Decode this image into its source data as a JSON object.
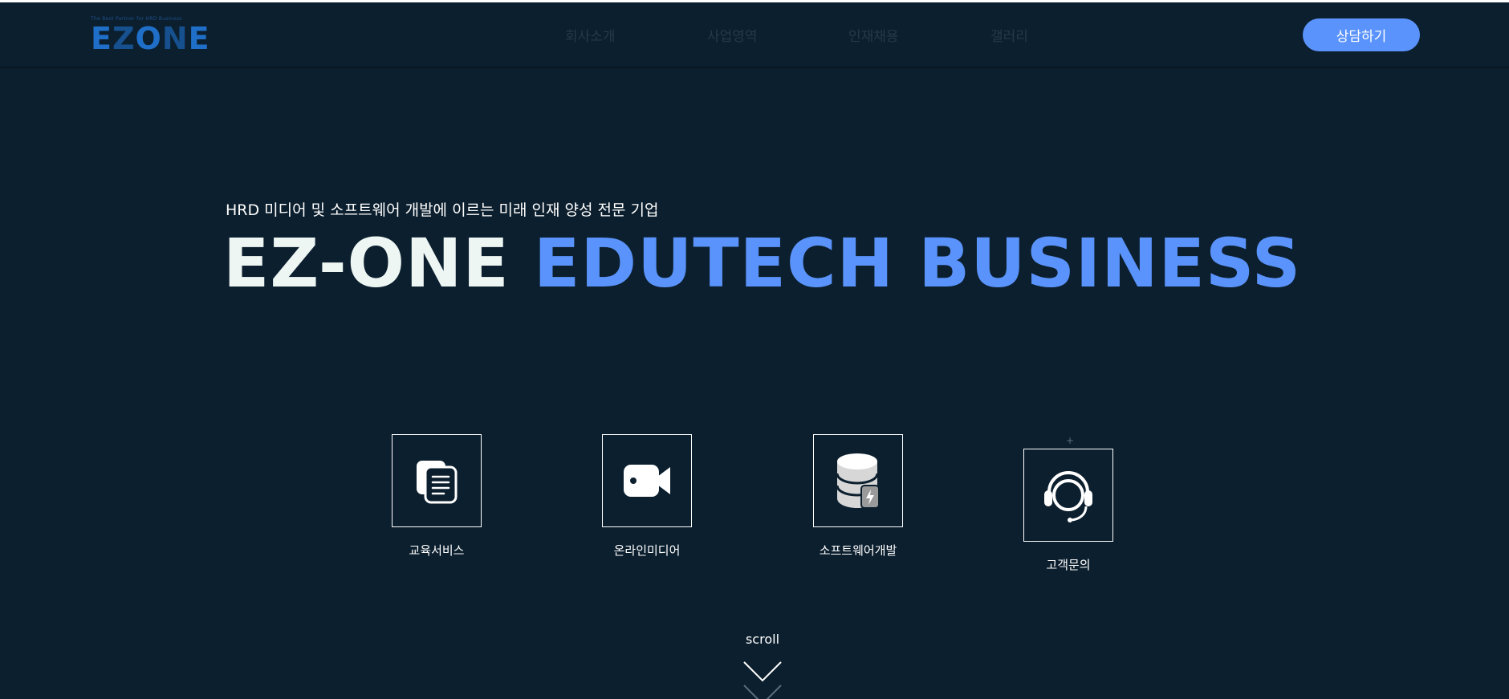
{
  "header": {
    "logo": {
      "tagline": "The Best Partner for HRD Business",
      "word": "EZONE"
    },
    "nav": [
      "회사소개",
      "사업영역",
      "인재채용",
      "갤러리"
    ],
    "cta_label": "상담하기"
  },
  "hero": {
    "subtitle": "HRD 미디어 및 소프트웨어 개발에 이르는 미래 인재 양성 전문 기업",
    "title_white": "EZ-ONE",
    "title_blue": "EDUTECH BUSINESS"
  },
  "services": [
    {
      "label": "교육서비스",
      "icon": "document-copy-icon"
    },
    {
      "label": "온라인미디어",
      "icon": "video-camera-icon"
    },
    {
      "label": "소프트웨어개발",
      "icon": "database-icon"
    },
    {
      "label": "고객문의",
      "icon": "headset-icon"
    }
  ],
  "scroll": {
    "label": "scroll"
  },
  "colors": {
    "background": "#0c1f2e",
    "accent": "#5a93fb",
    "nav_text": "#25394a"
  }
}
